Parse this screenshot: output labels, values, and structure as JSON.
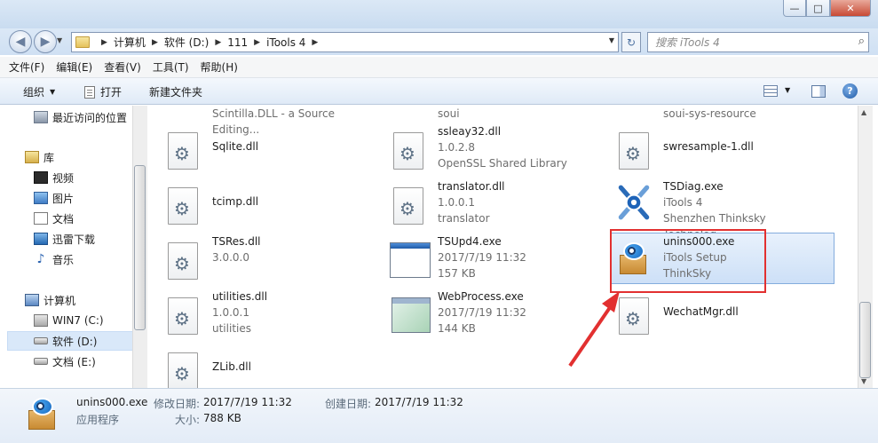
{
  "window": {
    "min_label": "—",
    "max_label": "□",
    "close_label": "✕"
  },
  "address": {
    "crumbs": [
      "计算机",
      "软件 (D:)",
      "111",
      "iTools 4"
    ]
  },
  "search": {
    "placeholder": "搜索 iTools 4"
  },
  "menu": [
    "文件(F)",
    "编辑(E)",
    "查看(V)",
    "工具(T)",
    "帮助(H)"
  ],
  "commands": {
    "organize": "组织",
    "open": "打开",
    "new_folder": "新建文件夹"
  },
  "nav": {
    "recent": "最近访问的位置",
    "library": "库",
    "video": "视频",
    "pictures": "图片",
    "documents": "文档",
    "thunder": "迅雷下载",
    "music": "音乐",
    "computer": "计算机",
    "drive_c": "WIN7 (C:)",
    "drive_d": "软件 (D:)",
    "drive_e": "文档 (E:)"
  },
  "partial_row": [
    "Scintilla.DLL - a Source Editing...",
    "soui",
    "soui-sys-resource"
  ],
  "files": [
    {
      "name": "Sqlite.dll",
      "line2": "",
      "line3": "",
      "icon": "dll-icon"
    },
    {
      "name": "ssleay32.dll",
      "line2": "1.0.2.8",
      "line3": "OpenSSL Shared Library",
      "icon": "dll-icon"
    },
    {
      "name": "swresample-1.dll",
      "line2": "",
      "line3": "",
      "icon": "dll-icon"
    },
    {
      "name": "tcimp.dll",
      "line2": "",
      "line3": "",
      "icon": "dll-icon"
    },
    {
      "name": "translator.dll",
      "line2": "1.0.0.1",
      "line3": "translator",
      "icon": "dll-icon"
    },
    {
      "name": "TSDiag.exe",
      "line2": "iTools 4",
      "line3": "Shenzhen Thinksky Technolog...",
      "icon": "tools-icon"
    },
    {
      "name": "TSRes.dll",
      "line2": "3.0.0.0",
      "line3": "",
      "icon": "dll-icon"
    },
    {
      "name": "TSUpd4.exe",
      "line2": "2017/7/19 11:32",
      "line3": "157 KB",
      "icon": "window-icon"
    },
    {
      "name": "unins000.exe",
      "line2": "iTools Setup",
      "line3": "ThinkSky",
      "icon": "itools-box-icon"
    },
    {
      "name": "utilities.dll",
      "line2": "1.0.0.1",
      "line3": "utilities",
      "icon": "dll-icon"
    },
    {
      "name": "WebProcess.exe",
      "line2": "2017/7/19 11:32",
      "line3": "144 KB",
      "icon": "web-process-icon"
    },
    {
      "name": "WechatMgr.dll",
      "line2": "",
      "line3": "",
      "icon": "dll-icon"
    },
    {
      "name": "ZLib.dll",
      "line2": "",
      "line3": "",
      "icon": "dll-icon"
    }
  ],
  "details": {
    "name": "unins000.exe",
    "type": "应用程序",
    "modified_label": "修改日期:",
    "modified_value": "2017/7/19 11:32",
    "created_label": "创建日期:",
    "created_value": "2017/7/19 11:32",
    "size_label": "大小:",
    "size_value": "788 KB"
  },
  "colors": {
    "highlight_box": "#e23030",
    "arrow": "#e23030",
    "selection": "#cde0f7"
  }
}
